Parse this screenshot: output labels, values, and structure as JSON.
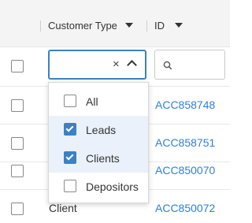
{
  "header": {
    "customer_type_label": "Customer Type",
    "id_label": "ID"
  },
  "filter": {
    "customer_type_value": "",
    "clear_glyph": "×",
    "search_icon": "search-icon"
  },
  "dropdown": {
    "options": [
      {
        "label": "All",
        "checked": false
      },
      {
        "label": "Leads",
        "checked": true
      },
      {
        "label": "Clients",
        "checked": true
      },
      {
        "label": "Depositors",
        "checked": false
      }
    ]
  },
  "rows": [
    {
      "customer_type": "",
      "id": "ACC858748"
    },
    {
      "customer_type": "",
      "id": "ACC858751"
    },
    {
      "customer_type": "",
      "id": "ACC850070"
    },
    {
      "customer_type": "Client",
      "id": "ACC850072"
    }
  ],
  "colors": {
    "accent": "#3b82c4",
    "link": "#2f7fd6",
    "header_bg": "#f4f4f4",
    "selected_option_bg": "#eaf1fb"
  }
}
